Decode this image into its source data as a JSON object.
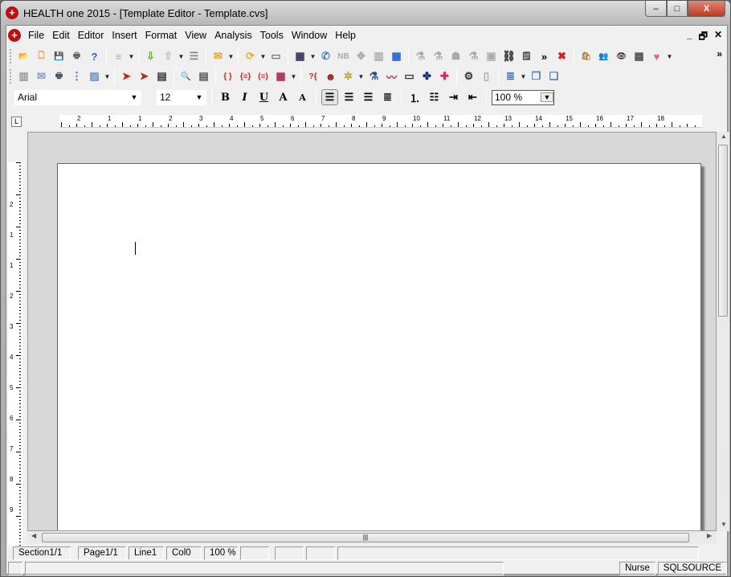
{
  "window": {
    "title": "HEALTH one 2015 - [Template Editor - Template.cvs]",
    "minimize": "–",
    "maximize": "□",
    "close": "X"
  },
  "menu": [
    "File",
    "Edit",
    "Editor",
    "Insert",
    "Format",
    "View",
    "Analysis",
    "Tools",
    "Window",
    "Help"
  ],
  "mdi_controls": {
    "minimize": "_",
    "restore": "🗗",
    "close": "✕"
  },
  "toolbar1": [
    {
      "icon": "open-folder-icon",
      "glyph": "📂",
      "color": "#e8b840"
    },
    {
      "icon": "new-document-icon",
      "glyph": "🗋",
      "color": "#e08a20"
    },
    {
      "icon": "save-icon",
      "glyph": "💾",
      "color": "#4050a0"
    },
    {
      "icon": "print-icon",
      "glyph": "🖶",
      "color": "#666"
    },
    {
      "icon": "help-icon",
      "glyph": "?",
      "color": "#2a62c8"
    },
    "sep",
    {
      "icon": "document-icon",
      "glyph": "≡",
      "color": "#aaa",
      "dd": true
    },
    "sep",
    {
      "icon": "import-icon",
      "glyph": "⇩",
      "color": "#6a4"
    },
    {
      "icon": "export-icon",
      "glyph": "⇧",
      "color": "#bbb",
      "dd": true
    },
    {
      "icon": "list-icon",
      "glyph": "☰",
      "color": "#888"
    },
    "sep",
    {
      "icon": "mail-icon",
      "glyph": "✉",
      "color": "#d8a830",
      "dd": true
    },
    "sep",
    {
      "icon": "refresh-icon",
      "glyph": "⟳",
      "color": "#e0b030",
      "dd": true
    },
    {
      "icon": "card-icon",
      "glyph": "▭",
      "color": "#777"
    },
    "sep",
    {
      "icon": "table-icon",
      "glyph": "▦",
      "color": "#335",
      "dd": true
    },
    {
      "icon": "phone-mail-icon",
      "glyph": "✆",
      "color": "#48a"
    },
    {
      "icon": "nb-icon",
      "glyph": "NB",
      "color": "#aaa"
    },
    {
      "icon": "puzzle-icon",
      "glyph": "✥",
      "color": "#aaa"
    },
    {
      "icon": "chart-icon",
      "glyph": "▥",
      "color": "#aaa"
    },
    {
      "icon": "grid-icon",
      "glyph": "▦",
      "color": "#2a62c8"
    },
    "sep",
    {
      "icon": "lab-icon",
      "glyph": "⚗",
      "color": "#aaa"
    },
    {
      "icon": "lab2-icon",
      "glyph": "⚗",
      "color": "#aaa"
    },
    {
      "icon": "person-lab-icon",
      "glyph": "☗",
      "color": "#aaa"
    },
    {
      "icon": "pill-icon",
      "glyph": "⚗",
      "color": "#aaa"
    },
    {
      "icon": "folder-icon",
      "glyph": "▣",
      "color": "#aaa"
    },
    {
      "icon": "binoculars-icon",
      "glyph": "⛓",
      "color": "#333"
    },
    {
      "icon": "notepad-icon",
      "glyph": "🗒",
      "color": "#444"
    },
    {
      "icon": "more-icon",
      "glyph": "»",
      "color": "#000"
    },
    {
      "icon": "stop-icon",
      "glyph": "✖",
      "color": "#d02020"
    },
    "sep",
    {
      "icon": "bag-icon",
      "glyph": "🛍",
      "color": "#b87333"
    },
    {
      "icon": "users-icon",
      "glyph": "👥",
      "color": "#c08030"
    },
    {
      "icon": "eye-icon",
      "glyph": "👁",
      "color": "#333"
    },
    {
      "icon": "cubes-icon",
      "glyph": "▩",
      "color": "#555"
    },
    {
      "icon": "heart-icon",
      "glyph": "♥",
      "color": "#e06080",
      "dd": true
    }
  ],
  "toolbar1_overflow": "»",
  "toolbar2": [
    {
      "icon": "cabinet-icon",
      "glyph": "▥",
      "color": "#999"
    },
    {
      "icon": "envelope-icon",
      "glyph": "✉",
      "color": "#7aa0d0"
    },
    {
      "icon": "printer-doc-icon",
      "glyph": "🖶",
      "color": "#456"
    },
    {
      "icon": "doc-list-icon",
      "glyph": "⋮",
      "color": "#2a62c8"
    },
    {
      "icon": "image-icon",
      "glyph": "▨",
      "color": "#6890c0",
      "dd": true
    },
    "sep",
    {
      "icon": "arrow-right-icon",
      "glyph": "➤",
      "color": "#d02020"
    },
    {
      "icon": "arrow-doc-icon",
      "glyph": "➤",
      "color": "#c02020"
    },
    {
      "icon": "save-doc-icon",
      "glyph": "▤",
      "color": "#333"
    },
    "sep",
    {
      "icon": "preview-icon",
      "glyph": "🔍",
      "color": "#4a80c0"
    },
    {
      "icon": "fields-icon",
      "glyph": "▤",
      "color": "#555"
    },
    "sep",
    {
      "icon": "braces-icon",
      "glyph": "{ }",
      "color": "#d02020"
    },
    {
      "icon": "braces-list-icon",
      "glyph": "{≡}",
      "color": "#d02020"
    },
    {
      "icon": "braces-lines-icon",
      "glyph": "(≡)",
      "color": "#d02020"
    },
    {
      "icon": "calendar-icon",
      "glyph": "▦",
      "color": "#a03050",
      "dd": true
    },
    "sep",
    {
      "icon": "question-brace-icon",
      "glyph": "?{",
      "color": "#d02020"
    },
    {
      "icon": "doctor-icon",
      "glyph": "☻",
      "color": "#902020"
    },
    {
      "icon": "sparkle-grid-icon",
      "glyph": "✲",
      "color": "#c0a020",
      "dd": true
    },
    {
      "icon": "medicine-icon",
      "glyph": "⚗",
      "color": "#2a4a9a"
    },
    {
      "icon": "graph-icon",
      "glyph": "〰",
      "color": "#a03050"
    },
    {
      "icon": "textbox-icon",
      "glyph": "▭",
      "color": "#333"
    },
    {
      "icon": "molecule-icon",
      "glyph": "✤",
      "color": "#1a2a7a"
    },
    {
      "icon": "medical-cross-icon",
      "glyph": "✚",
      "color": "#e02060"
    },
    "sep",
    {
      "icon": "gears-icon",
      "glyph": "⚙",
      "color": "#333"
    },
    {
      "icon": "clipboard-icon",
      "glyph": "▯",
      "color": "#aaa"
    },
    "sep",
    {
      "icon": "page-icon",
      "glyph": "≣",
      "color": "#2a62c8",
      "dd": true
    },
    {
      "icon": "copy-icon",
      "glyph": "❐",
      "color": "#4a80c0"
    },
    {
      "icon": "paste-icon",
      "glyph": "❏",
      "color": "#4a80c0"
    }
  ],
  "format": {
    "font": "Arial",
    "size": "12",
    "bold": "B",
    "italic": "I",
    "underline": "U",
    "grow": "A",
    "shrink": "A",
    "zoom": "100 %"
  },
  "ruler": {
    "labels": [
      "2",
      "1",
      "1",
      "2",
      "3",
      "4",
      "5",
      "6",
      "7",
      "8",
      "9",
      "10",
      "11",
      "12",
      "13",
      "14",
      "15",
      "16",
      "17",
      "18"
    ],
    "corner": "L"
  },
  "vruler": {
    "labels": [
      "2",
      "1",
      "1",
      "2",
      "3",
      "4",
      "5",
      "6",
      "7",
      "8",
      "9"
    ]
  },
  "status": {
    "section": "Section1/1",
    "page": "Page1/1",
    "line": "Line1",
    "col": "Col0",
    "zoom": "100 %",
    "user": "Nurse",
    "source": "SQLSOURCE"
  }
}
